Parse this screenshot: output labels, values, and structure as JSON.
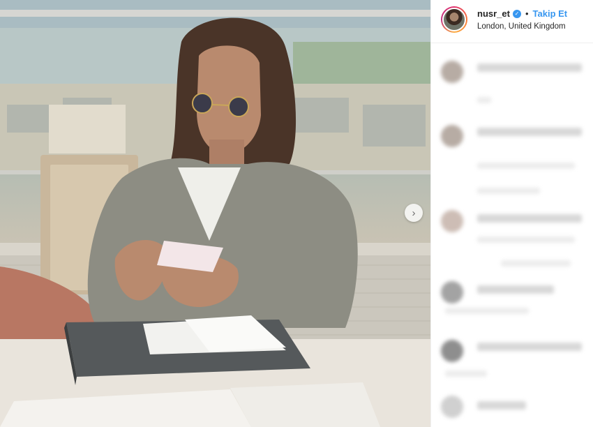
{
  "post": {
    "username": "nusr_et",
    "separator": "•",
    "follow_label": "Takip Et",
    "location": "London, United Kingdom",
    "verified_icon": "verified-badge-icon",
    "next_icon": "chevron-right-icon",
    "next_glyph": "›",
    "check_glyph": "✓"
  },
  "colors": {
    "accent": "#3897f0",
    "text": "#262626",
    "border": "#efefef"
  }
}
